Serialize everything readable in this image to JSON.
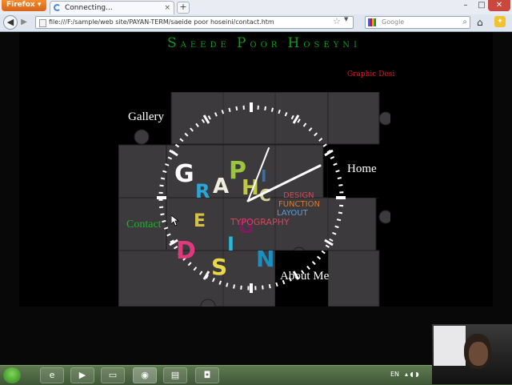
{
  "browser": {
    "app_menu": "Firefox",
    "tab_title": "Connecting...",
    "url": "file:///F:/sample/web site/PAYAN-TERM/saeide poor hoseini/contact.htm",
    "search_placeholder": "Google",
    "window_controls": [
      "minimize",
      "maximize",
      "close"
    ]
  },
  "page": {
    "title_parts": [
      {
        "cap": "S",
        "rest": "AEEDE"
      },
      {
        "cap": "P",
        "rest": "OOR"
      },
      {
        "cap": "H",
        "rest": "OSEYNI"
      }
    ],
    "graphic_label": "Graphic Desi",
    "nav": {
      "gallery": "Gallery",
      "home": "Home",
      "contact": "Contact",
      "about": "About Me"
    },
    "artwork": {
      "letters": [
        "G",
        "R",
        "A",
        "P",
        "H",
        "I",
        "C",
        "D",
        "E",
        "S",
        "I",
        "G",
        "N"
      ],
      "words": [
        "DESIGN",
        "FUNCTION",
        "LAYOUT",
        "TYPOGRAPHY"
      ]
    }
  },
  "taskbar": {
    "items": [
      "ie-icon",
      "media-player-icon",
      "folder-icon",
      "firefox-icon",
      "notes-icon",
      "camera-icon"
    ],
    "language": "EN"
  },
  "colors": {
    "site_title": "#0c9a17",
    "graphic_label": "#e5151a",
    "contact_link": "#1bb42d",
    "puzzle": "#3d3a3d"
  }
}
